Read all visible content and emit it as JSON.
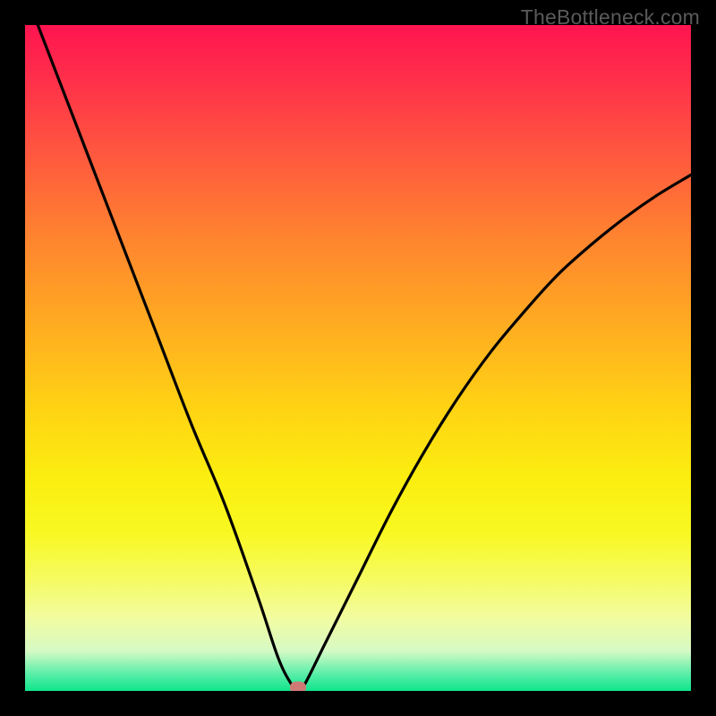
{
  "watermark": "TheBottleneck.com",
  "chart_data": {
    "type": "line",
    "title": "",
    "xlabel": "",
    "ylabel": "",
    "xlim": [
      0,
      100
    ],
    "ylim": [
      0,
      100
    ],
    "series": [
      {
        "name": "curve",
        "x": [
          0,
          5,
          10,
          15,
          20,
          25,
          30,
          35,
          38,
          40,
          41,
          42,
          45,
          50,
          55,
          60,
          65,
          70,
          75,
          80,
          85,
          90,
          95,
          100
        ],
        "values": [
          105,
          92,
          79,
          66,
          53,
          40,
          28,
          14,
          5,
          1,
          0,
          1,
          7,
          17,
          27,
          36,
          44,
          51,
          57,
          62.5,
          67,
          71,
          74.5,
          77.5
        ]
      }
    ],
    "marker": {
      "x": 41,
      "y": 0.6
    },
    "gradient_stops": [
      {
        "pos": 0,
        "color": "#ff1450"
      },
      {
        "pos": 0.5,
        "color": "#ffd413"
      },
      {
        "pos": 1.0,
        "color": "#10e58c"
      }
    ]
  }
}
